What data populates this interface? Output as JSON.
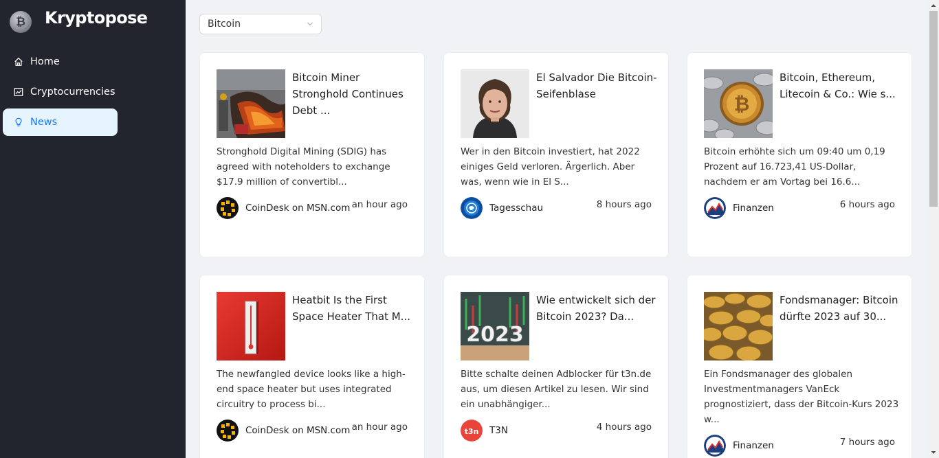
{
  "app": {
    "title": "Kryptopose",
    "logo_symbol": "₿"
  },
  "sidebar": {
    "items": [
      {
        "label": "Home",
        "icon": "home-icon"
      },
      {
        "label": "Cryptocurrencies",
        "icon": "chart-icon"
      },
      {
        "label": "News",
        "icon": "bulb-icon",
        "active": true
      }
    ]
  },
  "filter": {
    "selected": "Bitcoin"
  },
  "colors": {
    "sidebar_bg": "#22252e",
    "active_bg": "#e6f4ff",
    "active_text": "#1677ff",
    "page_bg": "#f0f2f5"
  },
  "news": [
    {
      "title": "Bitcoin Miner Stronghold Continues Debt ...",
      "description": "Stronghold Digital Mining (SDIG) has agreed with noteholders to exchange $17.9 million of convertibl...",
      "provider": "CoinDesk on MSN.com",
      "time": "an hour ago"
    },
    {
      "title": "El Salvador Die Bitcoin-Seifenblase",
      "description": "Wer in den Bitcoin investiert, hat 2022 einiges Geld verloren. Ärgerlich. Aber was, wenn wie in El S...",
      "provider": "Tagesschau",
      "time": "8 hours ago"
    },
    {
      "title": "Bitcoin, Ethereum, Litecoin & Co.: Wie s...",
      "description": "Bitcoin erhöhte sich um 09:40 um 0,19 Prozent auf 16.723,41 US-Dollar, nachdem er am Vortag bei 16.6...",
      "provider": "Finanzen",
      "time": "6 hours ago"
    },
    {
      "title": "Heatbit Is the First Space Heater That M...",
      "description": "The newfangled device looks like a high-end space heater but uses integrated circuitry to process bi...",
      "provider": "CoinDesk on MSN.com",
      "time": "an hour ago"
    },
    {
      "title": "Wie entwickelt sich der Bitcoin 2023? Da...",
      "description": "Bitte schalte deinen Adblocker für t3n.de aus, um diesen Artikel zu lesen. Wir sind ein unabhängiger...",
      "provider": "T3N",
      "time": "4 hours ago",
      "thumb_text": "2023",
      "provider_logo_text": "t3n"
    },
    {
      "title": "Fondsmanager: Bitcoin dürfte 2023 auf 30...",
      "description": "Ein Fondsmanager des globalen Investmentmanagers VanEck prognostiziert, dass der Bitcoin-Kurs 2023 w...",
      "provider": "Finanzen",
      "time": "7 hours ago"
    }
  ]
}
